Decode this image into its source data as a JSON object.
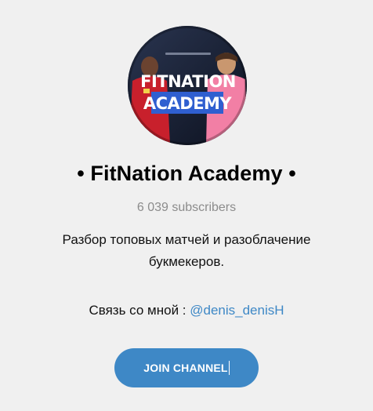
{
  "channel": {
    "avatar": {
      "line1": "FITNATION",
      "line2": "ACADEMY"
    },
    "title": "• FitNation Academy •",
    "subscribers": "6 039 subscribers",
    "description": "Разбор топовых матчей и разоблачение букмекеров.",
    "contact_label": "Связь со мной : ",
    "contact_link": "@denis_denisH",
    "join_button": "JOIN CHANNEL"
  },
  "colors": {
    "accent": "#3e88c6",
    "background": "#f0f0f0",
    "muted_text": "#8c8c8c"
  }
}
